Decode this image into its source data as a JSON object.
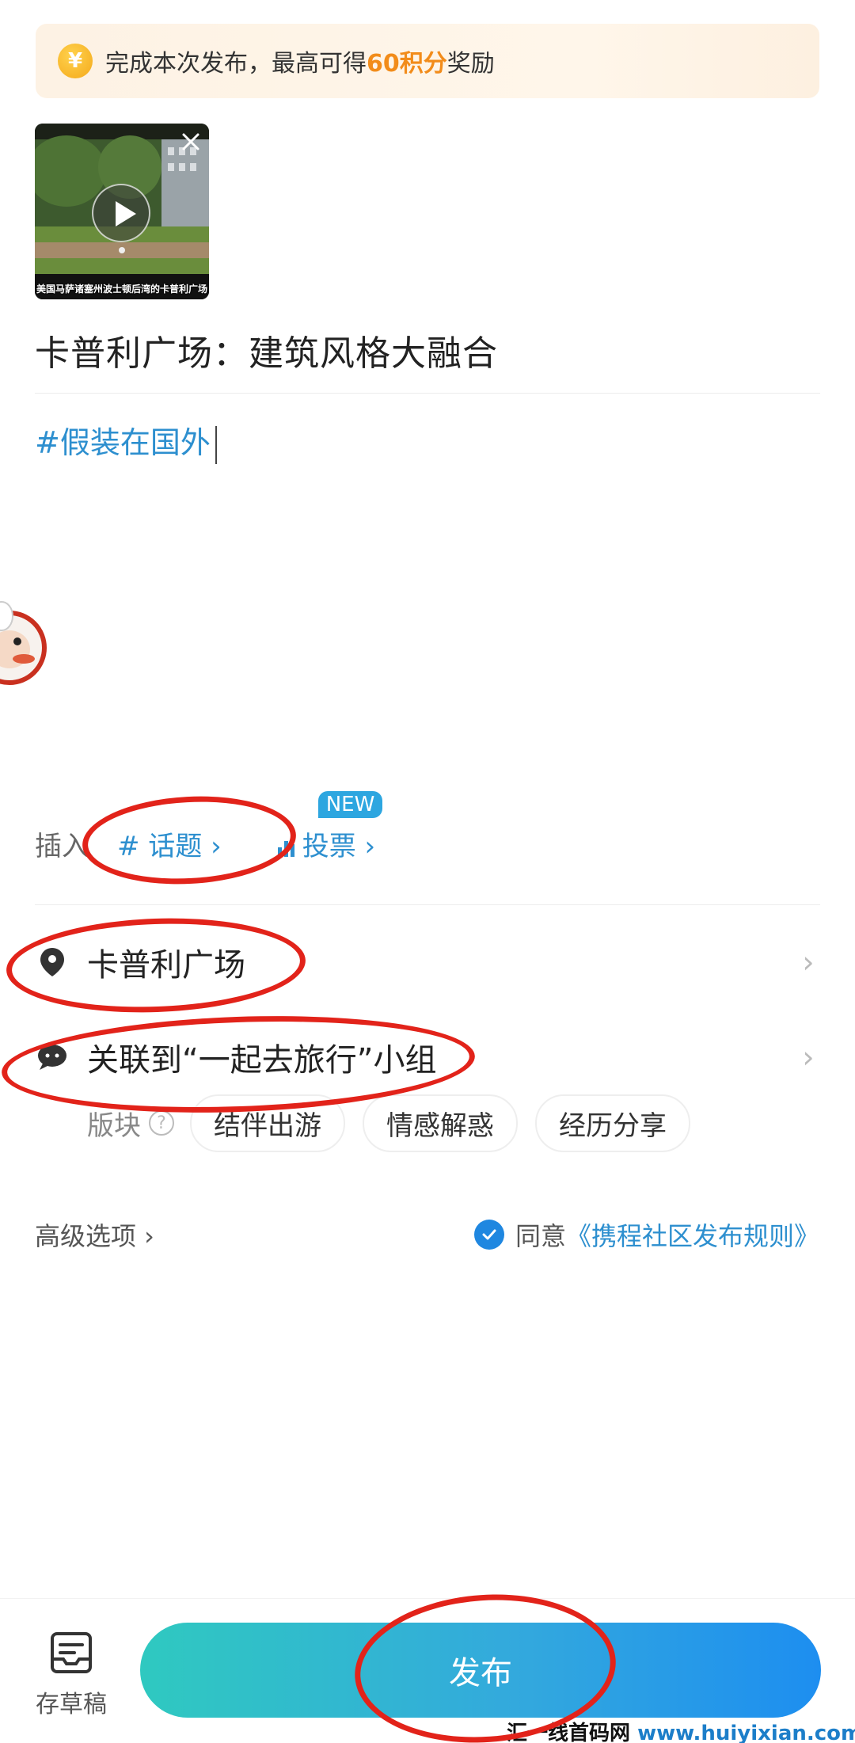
{
  "banner": {
    "icon": "coin-icon",
    "text_prefix": "完成本次发布，最高可得",
    "text_highlight": "60积分",
    "text_suffix": "奖励",
    "highlight_color": "#f28c1a"
  },
  "video": {
    "caption": "美国马萨诸塞州波士顿后湾的卡普利广场",
    "close_icon": "close-icon",
    "play_icon": "play-icon"
  },
  "post": {
    "title": "卡普利广场：建筑风格大融合",
    "hashtag": "#假装在国外"
  },
  "insert": {
    "label": "插入",
    "topic_label": "# 话题 ›",
    "vote_label": "投票 ›",
    "new_badge": "NEW"
  },
  "location": {
    "icon": "location-pin-icon",
    "label": "卡普利广场"
  },
  "group": {
    "icon": "chat-bubble-icon",
    "label": "关联到“一起去旅行”小组"
  },
  "board": {
    "label": "版块",
    "tags": [
      "结伴出游",
      "情感解惑",
      "经历分享"
    ]
  },
  "advanced": {
    "label": "高级选项 ›"
  },
  "agreement": {
    "prefix": "同意",
    "link": "《携程社区发布规则》",
    "checked": true,
    "check_color": "#1f87e0"
  },
  "footer": {
    "draft_label": "存草稿",
    "draft_icon": "draft-box-icon",
    "publish_label": "发布"
  },
  "watermark": {
    "cn": "汇一线首码网",
    "url": "www.huiyixian.com"
  },
  "colors": {
    "accent_blue": "#2d8fcf",
    "annotation_red": "#e2231a"
  }
}
